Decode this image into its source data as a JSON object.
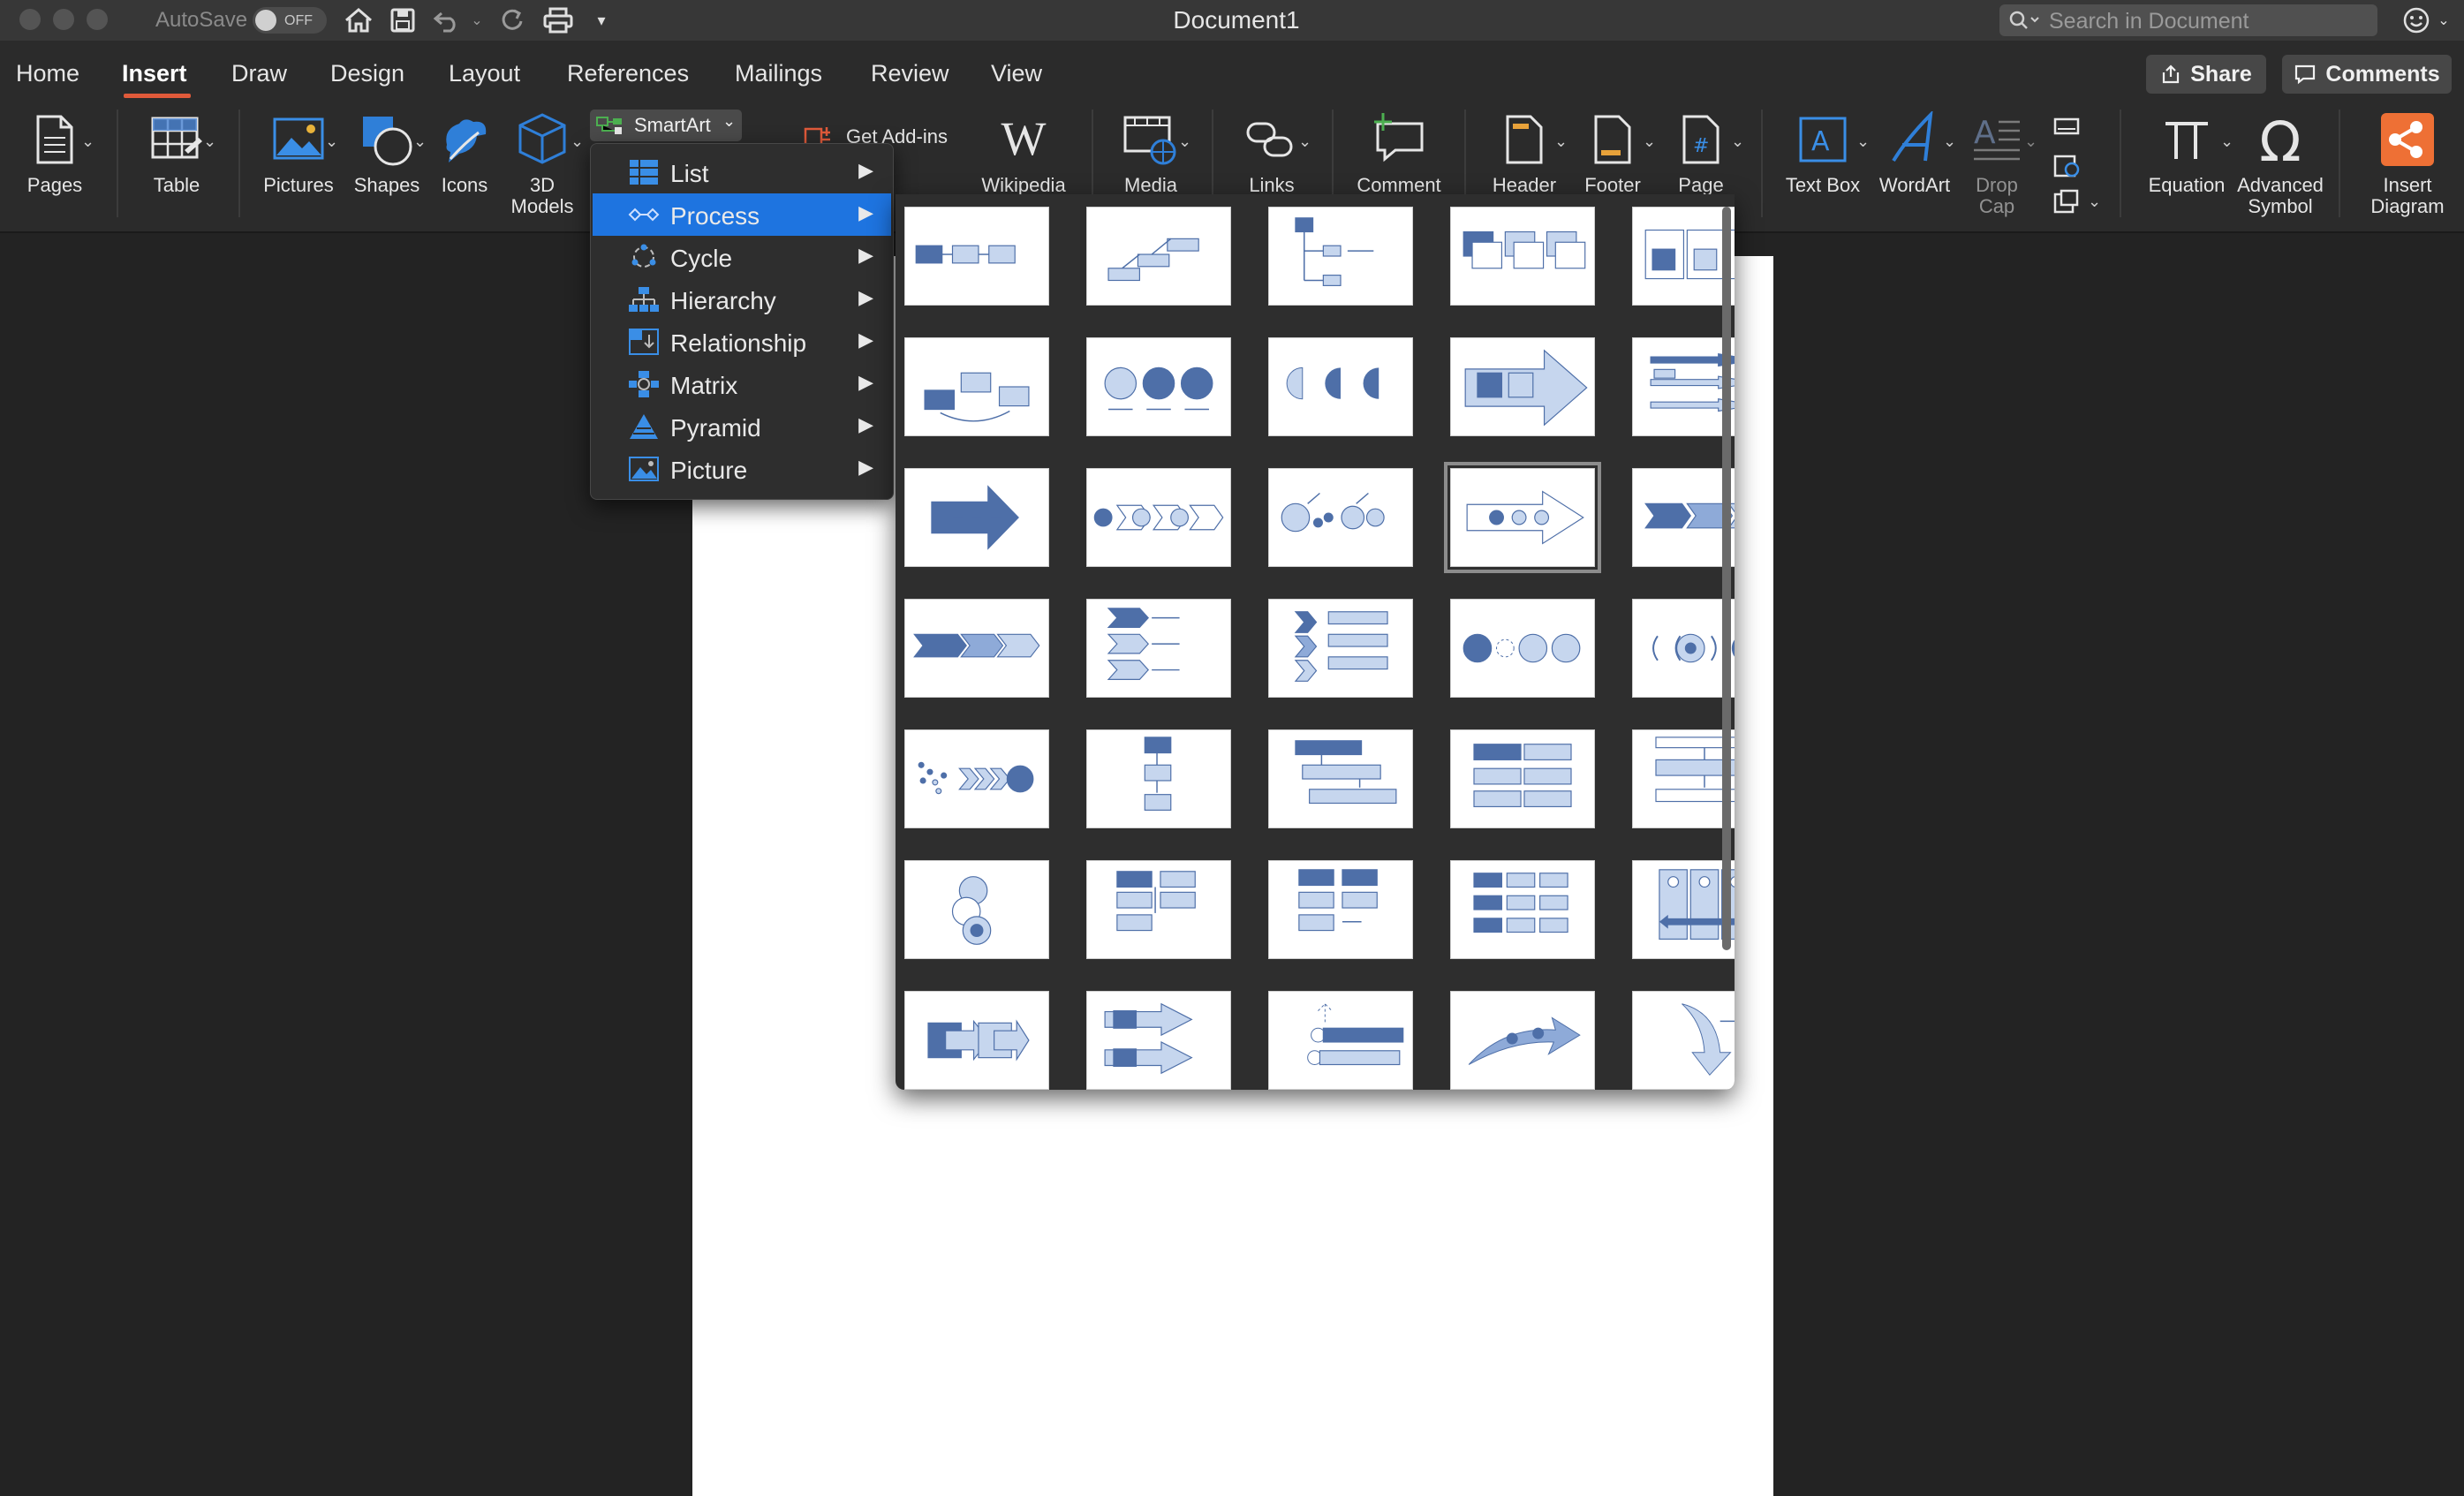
{
  "window": {
    "title": "Document1",
    "autosave_label": "AutoSave",
    "autosave_state": "OFF",
    "search_placeholder": "Search in Document"
  },
  "tabs": [
    "Home",
    "Insert",
    "Draw",
    "Design",
    "Layout",
    "References",
    "Mailings",
    "Review",
    "View"
  ],
  "active_tab": "Insert",
  "header_buttons": {
    "share": "Share",
    "comments": "Comments"
  },
  "ribbon": {
    "pages": "Pages",
    "table": "Table",
    "pictures": "Pictures",
    "shapes": "Shapes",
    "icons": "Icons",
    "models_line1": "3D",
    "models_line2": "Models",
    "smartart": "SmartArt",
    "get_addins": "Get Add-ins",
    "wikipedia": "Wikipedia",
    "media": "Media",
    "links": "Links",
    "comment": "Comment",
    "header": "Header",
    "footer": "Footer",
    "page": "Page",
    "text_box": "Text Box",
    "wordart": "WordArt",
    "drop_line1": "Drop",
    "drop_line2": "Cap",
    "equation": "Equation",
    "adv_line1": "Advanced",
    "adv_line2": "Symbol",
    "insert_line1": "Insert",
    "insert_line2": "Diagram"
  },
  "smartart_menu": [
    {
      "label": "List",
      "icon": "list-icon",
      "selected": false
    },
    {
      "label": "Process",
      "icon": "process-icon",
      "selected": true
    },
    {
      "label": "Cycle",
      "icon": "cycle-icon",
      "selected": false
    },
    {
      "label": "Hierarchy",
      "icon": "hierarchy-icon",
      "selected": false
    },
    {
      "label": "Relationship",
      "icon": "relationship-icon",
      "selected": false
    },
    {
      "label": "Matrix",
      "icon": "matrix-icon",
      "selected": false
    },
    {
      "label": "Pyramid",
      "icon": "pyramid-icon",
      "selected": false
    },
    {
      "label": "Picture",
      "icon": "picture-icon",
      "selected": false
    }
  ],
  "gallery": {
    "rows": 8,
    "cols": 5,
    "selected_row": 2,
    "selected_col": 3,
    "dark": "#4e6fa8",
    "light": "#c6d6ee",
    "mid": "#8eaad8"
  },
  "colors": {
    "accent": "#1e74e0",
    "tab_underline": "#e05a3a",
    "insert_diagram": "#ee7035"
  }
}
